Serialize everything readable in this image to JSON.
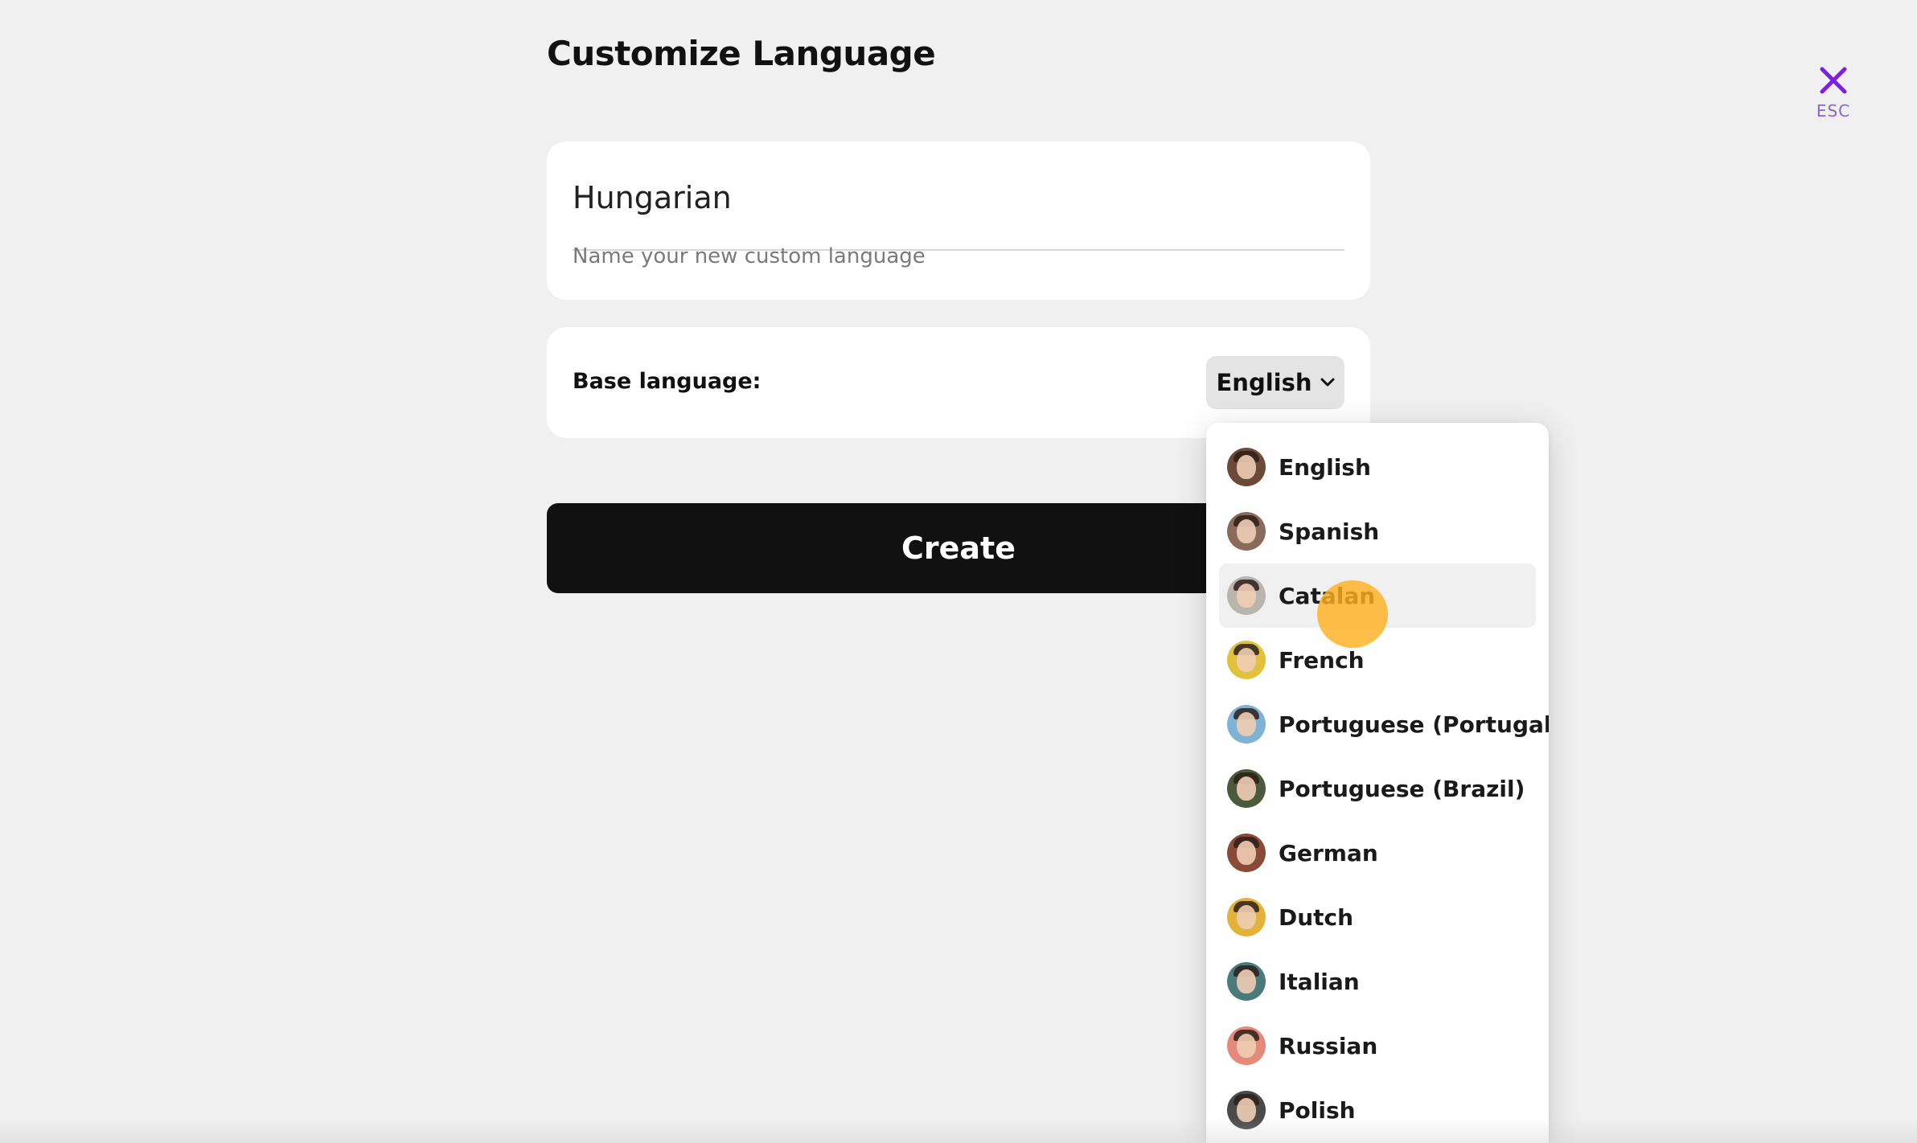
{
  "page": {
    "title": "Customize Language"
  },
  "close": {
    "label": "ESC",
    "icon": "close-icon",
    "color": "#7b1fe6"
  },
  "name_field": {
    "value": "Hungarian",
    "helper": "Name your new custom language"
  },
  "base_language": {
    "label": "Base language:",
    "selected": "English",
    "icon": "chevron-down-icon"
  },
  "create_button": {
    "label": "Create"
  },
  "dropdown": {
    "hovered": "Catalan",
    "items": [
      {
        "label": "English",
        "icon": "avatar-english",
        "color": "#6b4a3a"
      },
      {
        "label": "Spanish",
        "icon": "avatar-spanish",
        "color": "#8a6a5a"
      },
      {
        "label": "Catalan",
        "icon": "avatar-catalan",
        "color": "#b9b4ae"
      },
      {
        "label": "French",
        "icon": "avatar-french",
        "color": "#e0c23c"
      },
      {
        "label": "Portuguese (Portugal)",
        "icon": "avatar-portuguese-portugal",
        "color": "#7fb3d5"
      },
      {
        "label": "Portuguese (Brazil)",
        "icon": "avatar-portuguese-brazil",
        "color": "#4a5a3a"
      },
      {
        "label": "German",
        "icon": "avatar-german",
        "color": "#8a4a3a"
      },
      {
        "label": "Dutch",
        "icon": "avatar-dutch",
        "color": "#e2b23a"
      },
      {
        "label": "Italian",
        "icon": "avatar-italian",
        "color": "#4a7a7a"
      },
      {
        "label": "Russian",
        "icon": "avatar-russian",
        "color": "#e58a7a"
      },
      {
        "label": "Polish",
        "icon": "avatar-polish",
        "color": "#4a4a4a"
      }
    ]
  },
  "cursor": {
    "color": "#ffb020"
  }
}
